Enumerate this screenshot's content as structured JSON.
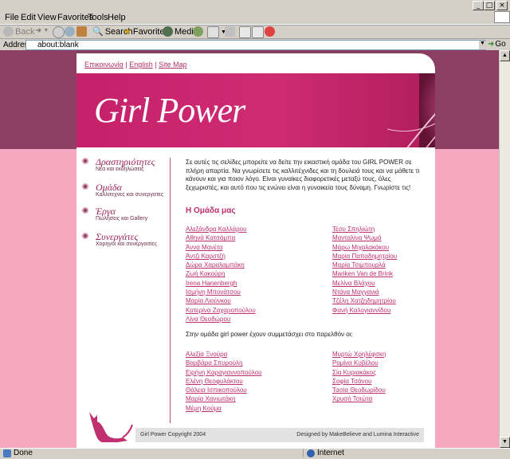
{
  "menu": [
    "File",
    "Edit",
    "View",
    "Favorites",
    "Tools",
    "Help"
  ],
  "toolbar": {
    "back": "Back",
    "search": "Search",
    "favorites": "Favorites",
    "media": "Media"
  },
  "address": {
    "label": "Address",
    "value": "about:blank",
    "go": "Go"
  },
  "site": {
    "top_links": [
      "Επικοινωνία",
      "English",
      "Site Map"
    ],
    "logo": "Girl Power",
    "nav": [
      {
        "title": "Δραστηριότητες",
        "sub": "Νέα και εκδηλώσεις"
      },
      {
        "title": "Ομάδα",
        "sub": "Καλλιτεχνες και συνεργατες"
      },
      {
        "title": "Έργα",
        "sub": "Πωλήσεις και Gallery"
      },
      {
        "title": "Συνεργάτες",
        "sub": "Χορηγοί και συνεργασίες"
      }
    ],
    "intro": "Σε αυτές τις σελίδες μπορείτε να δείτε την εικαστική ομάδα του GIRL POWER σε πλήρη απαρτία. Να γνωρίσετε τις καλλιτέχνιδες και τη δουλειά τους και να μάθετε τι κάνουν και για ποιον λόγο. Είναι γυναίκες διαφορετικές μεταξύ τους, όλες ξεχωριστές, και αυτό που τις ενώνει είναι η γυναικεία τους δύναμη. Γνωρίστε τις!",
    "team_heading": "Η Ομάδα μας",
    "team_left": [
      "Αλεξάνδρα Καλλάρου",
      "Αθηνά Κατσάμπα",
      "Άννα Μανέτα",
      "Άντζι Καρστζή",
      "Δώρα Χαραλαμπάκη",
      "Ζωή Κακούρη",
      "Irena Hanenbergh",
      "Ισμήνη Μπονάτσου",
      "Μαρία Λιούνκου",
      "Κατερίνα Ζαχαροπούλου",
      "Λίνα Θεοδώρου"
    ],
    "team_right": [
      "Τέσυ Σπηλιώτη",
      "Μανταλίνα Ψωμά",
      "Μάρω Μιχαλακάκου",
      "Μαρία Παπαδημητρίου",
      "Μαρία Τσιμπουρλά",
      "Mariken Van de Brink",
      "Μελίνα Βλάχου",
      "Ντάνα Μαγγανιά",
      "Τζέλη Χατζηδημητρίου",
      "Φανή Καλογιαννίδου"
    ],
    "participants_text": "Στην ομάδα girl power έχουν συμμετάσχει στο παρελθόν οι:",
    "past_left": [
      "Αλεξία Ξνούρα",
      "Βαρβάρα Σπυρούλη",
      "Ειρήνη Καραγιαννοπούλου",
      "Ελένη Θεοφυλάκτου",
      "Θάλεια Ισπικοπούλου",
      "Μαρία Χανιωτάκη",
      "Μέμη Κούμα"
    ],
    "past_right": [
      "Μυρτώ Χρηλέφσκη",
      "Ρομίνα Κυβέλου",
      "Σία Κυριακάκος",
      "Σοφία Τσάνου",
      "Τασία Θεοδωρίδου",
      "Χρυσή Τσιώτα"
    ],
    "copyright": "Girl Power Copyright 2004",
    "designed_by": "Designed by MakeBelieve and Lumina Interactive"
  },
  "status": {
    "left": "Done",
    "zone": "Internet"
  }
}
